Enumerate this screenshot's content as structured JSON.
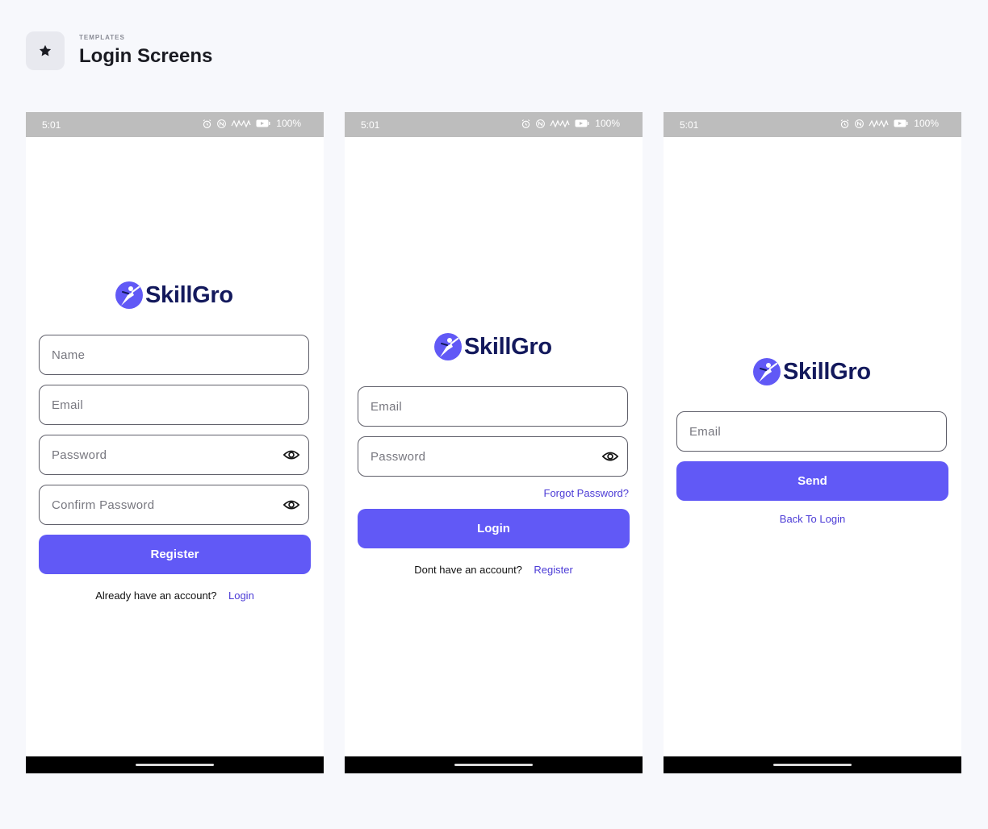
{
  "header": {
    "eyebrow": "TEMPLATES",
    "title": "Login Screens",
    "icon": "star-icon"
  },
  "statusbar": {
    "time": "5:01",
    "battery": "100%",
    "icons": [
      "alarm-icon",
      "nfc-icon",
      "vibrate-icon",
      "battery-icon"
    ]
  },
  "brand": {
    "name": "SkillGro",
    "logo_icon": "skillgro-logo-icon",
    "accent_color": "#6159f6",
    "text_color": "#13195c"
  },
  "register_screen": {
    "name_placeholder": "Name",
    "email_placeholder": "Email",
    "password_placeholder": "Password",
    "confirm_password_placeholder": "Confirm Password",
    "submit_label": "Register",
    "footer_text": "Already have an account?",
    "footer_link": "Login"
  },
  "login_screen": {
    "email_placeholder": "Email",
    "password_placeholder": "Password",
    "forgot_label": "Forgot Password?",
    "submit_label": "Login",
    "footer_text": "Dont have an account?",
    "footer_link": "Register"
  },
  "forgot_screen": {
    "email_placeholder": "Email",
    "submit_label": "Send",
    "back_link": "Back To Login"
  }
}
